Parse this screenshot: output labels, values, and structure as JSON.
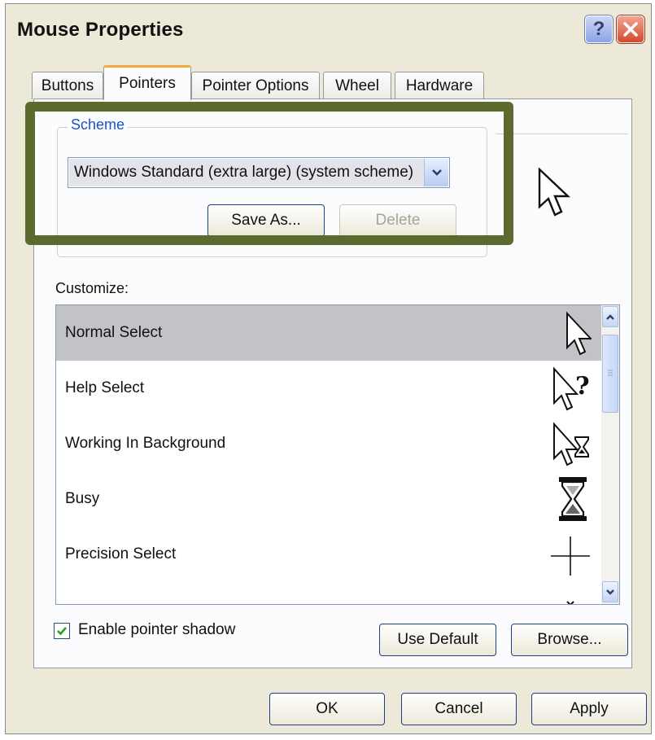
{
  "window": {
    "title": "Mouse Properties",
    "help_label": "?"
  },
  "tabs": [
    {
      "label": "Buttons"
    },
    {
      "label": "Pointers"
    },
    {
      "label": "Pointer Options"
    },
    {
      "label": "Wheel"
    },
    {
      "label": "Hardware"
    }
  ],
  "scheme": {
    "legend": "Scheme",
    "selected": "Windows Standard (extra large) (system scheme)",
    "save_as": "Save As...",
    "delete": "Delete"
  },
  "customize": {
    "label": "Customize:",
    "items": [
      {
        "label": "Normal Select",
        "icon": "arrow-cursor-icon"
      },
      {
        "label": "Help Select",
        "icon": "help-cursor-icon"
      },
      {
        "label": "Working In Background",
        "icon": "working-cursor-icon"
      },
      {
        "label": "Busy",
        "icon": "hourglass-icon"
      },
      {
        "label": "Precision Select",
        "icon": "crosshair-icon"
      }
    ]
  },
  "options": {
    "shadow_label": "Enable pointer shadow",
    "shadow_checked": true
  },
  "buttons": {
    "use_default": "Use Default",
    "browse": "Browse...",
    "ok": "OK",
    "cancel": "Cancel",
    "apply": "Apply"
  },
  "colors": {
    "highlight_border": "#5c6a2e",
    "selected_row": "#c3c3c7",
    "active_tab_accent": "#f3a93f"
  }
}
